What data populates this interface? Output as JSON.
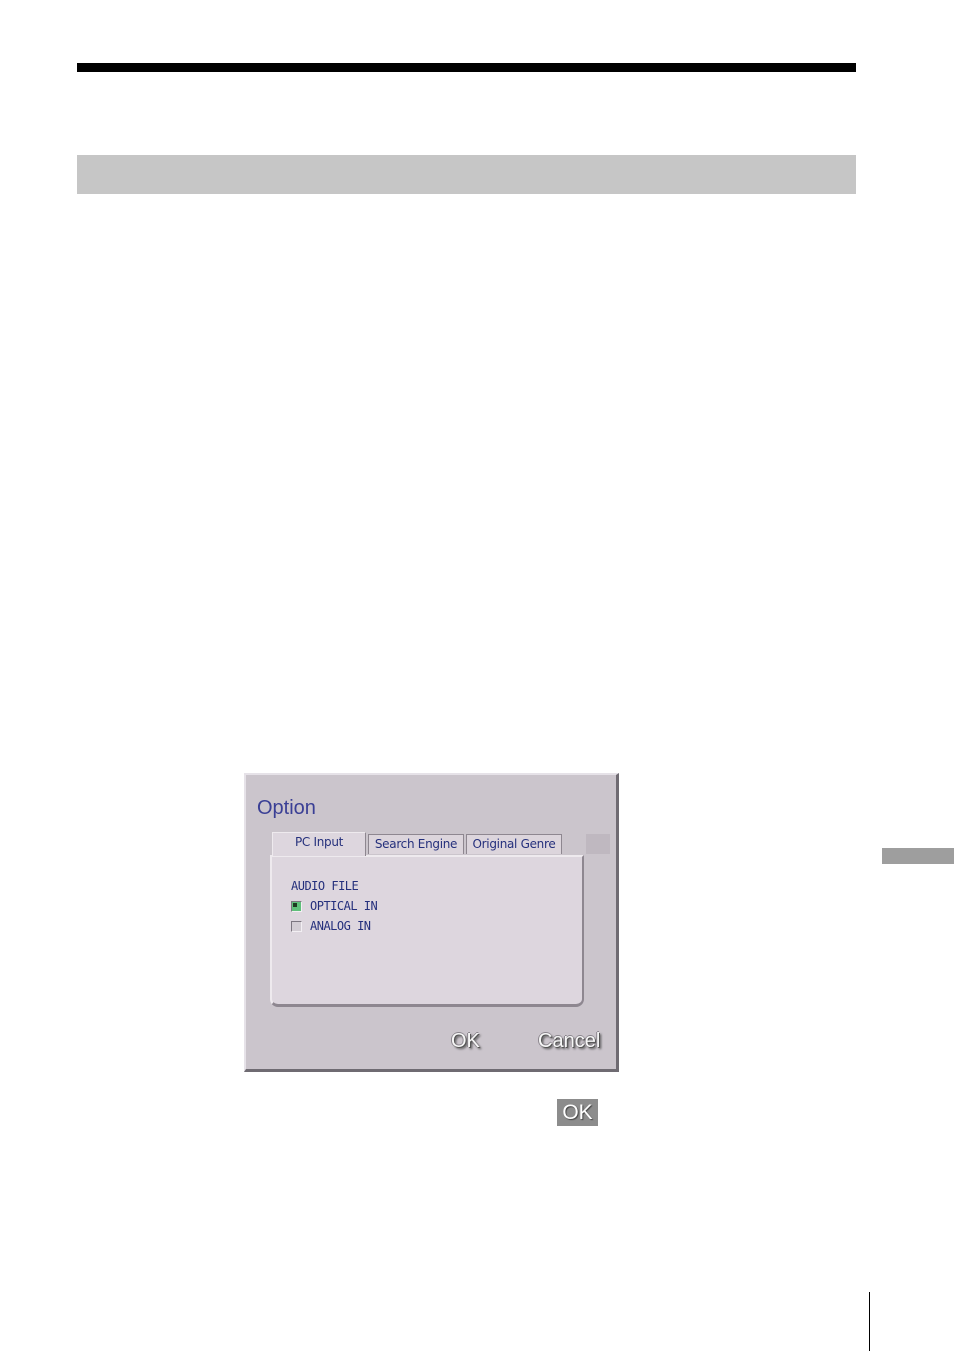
{
  "dialog": {
    "title": "Option",
    "tabs": [
      {
        "label": "PC Input",
        "active": true
      },
      {
        "label": "Search Engine",
        "active": false
      },
      {
        "label": "Original Genre",
        "active": false
      }
    ],
    "group_label": "AUDIO FILE",
    "options": [
      {
        "label": "OPTICAL IN",
        "checked": true
      },
      {
        "label": "ANALOG IN",
        "checked": false
      }
    ],
    "ok_label": "OK",
    "cancel_label": "Cancel"
  },
  "inline_button_label": "OK",
  "colors": {
    "dialog_bg": "#cbc5cc",
    "panel_bg": "#ddd6de",
    "title_text": "#3a3f95",
    "control_text": "#25307c",
    "checkbox_checked": "#5fc07a",
    "section_band": "#c6c6c6",
    "side_tab": "#9e9e9e"
  }
}
